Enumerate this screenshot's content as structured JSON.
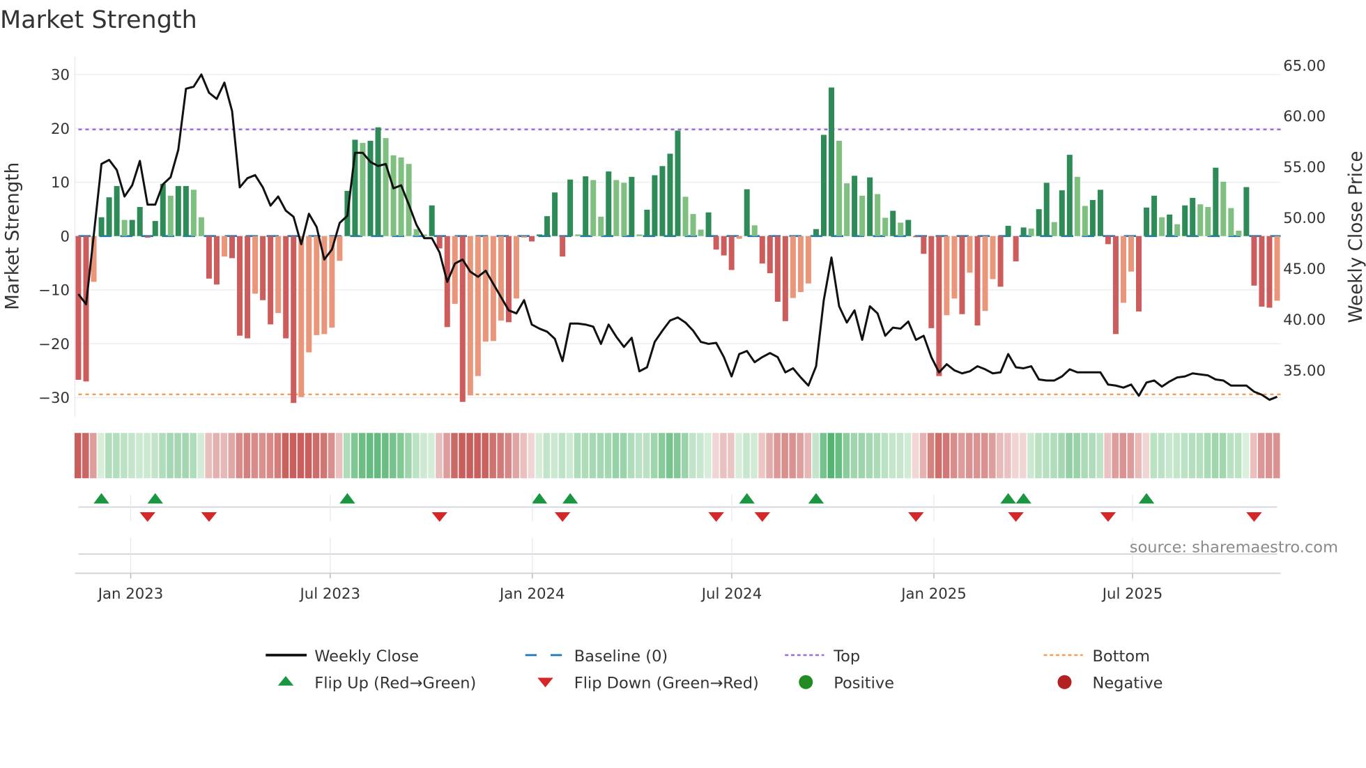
{
  "chart_data": {
    "type": "bar",
    "title": "Market Strength",
    "ylabel": "Market Strength",
    "y2label": "Weekly Close Price",
    "ylim": [
      -33.5,
      33.3
    ],
    "y2lim": [
      30.5,
      65.9
    ],
    "yticks": [
      "30",
      "20",
      "10",
      "0",
      "−10",
      "−20",
      "−30"
    ],
    "ytick_values": [
      30,
      20,
      10,
      0,
      -10,
      -20,
      -30
    ],
    "y2ticks": [
      "65.00",
      "60.00",
      "55.00",
      "50.00",
      "45.00",
      "40.00",
      "35.00"
    ],
    "y2tick_values": [
      65,
      60,
      55,
      50,
      45,
      40,
      35
    ],
    "xticks": [
      "Jan 2023",
      "Jul 2023",
      "Jan 2024",
      "Jul 2024",
      "Jan 2025",
      "Jul 2025"
    ],
    "grid": true,
    "top_level": 19.8,
    "bottom_level": -29.4,
    "series": [
      {
        "name": "Market Strength",
        "type": "bar",
        "values": [
          -26.7,
          -27,
          -8.5,
          3.5,
          7.2,
          9.3,
          3,
          3,
          5.4,
          -0.3,
          2.8,
          9.7,
          7.5,
          9.3,
          9.3,
          8.6,
          3.5,
          -7.9,
          -9,
          -3.8,
          -4.1,
          -18.5,
          -19,
          -10.7,
          -11.9,
          -16.4,
          -14.3,
          -19,
          -31,
          -29.9,
          -21.6,
          -18.4,
          -18.2,
          -17,
          -4.6,
          8.4,
          17.9,
          17.3,
          17.7,
          20.2,
          18.2,
          15,
          14.6,
          13.4,
          1.3,
          0.3,
          5.7,
          -2.3,
          -16.9,
          -12.6,
          -30.8,
          -29.6,
          -26,
          -19.6,
          -19.5,
          -15.7,
          -16,
          -11.6,
          -0.3,
          -1,
          0.3,
          3.7,
          8.1,
          -3.8,
          10.5,
          0.3,
          11.1,
          10.4,
          3.6,
          12,
          10.4,
          9.9,
          11,
          0.3,
          4.9,
          11.3,
          13,
          15.3,
          19.6,
          7.3,
          4.1,
          1.2,
          4.4,
          -2.5,
          -3.6,
          -6.3,
          -0.5,
          8.7,
          2,
          -5.1,
          -6.9,
          -12.2,
          -15.8,
          -11.5,
          -10.4,
          -8.8,
          1.3,
          18.8,
          27.6,
          17.7,
          9.8,
          11.2,
          7.5,
          10.9,
          7.8,
          3.4,
          4.7,
          2.5,
          3,
          -0.2,
          -3.3,
          -17.1,
          -26,
          -14.7,
          -11.6,
          -14.5,
          -6.8,
          -16.6,
          -13.9,
          -8,
          -9.4,
          1.9,
          -4.7,
          1.6,
          1.4,
          5,
          9.9,
          2.6,
          8.5,
          15.1,
          11,
          5.6,
          6.7,
          8.6,
          -1.5,
          -18.2,
          -12.4,
          -6.6,
          -14,
          5.3,
          7.5,
          3.5,
          4,
          2.2,
          5.7,
          7.1,
          5.9,
          5.4,
          12.7,
          10.1,
          5.2,
          1,
          9.1,
          -9.2,
          -13.1,
          -13.3,
          -12
        ]
      },
      {
        "name": "Weekly Close",
        "type": "line",
        "axis": "right",
        "values": [
          42.5,
          41.5,
          48.3,
          55.3,
          55.7,
          54.7,
          52.1,
          53.2,
          55.6,
          51.3,
          51.3,
          53.3,
          54,
          56.7,
          62.7,
          62.9,
          64.1,
          62.3,
          61.7,
          63.3,
          60.5,
          53,
          53.9,
          54.2,
          53,
          51.2,
          52.1,
          50.7,
          50.1,
          47.4,
          50.4,
          49.1,
          45.9,
          46.9,
          49.5,
          50.2,
          56.4,
          56.4,
          55.5,
          55.1,
          55.3,
          52.9,
          53.2,
          51.3,
          49.3,
          48,
          48,
          46.6,
          43.7,
          45.5,
          45.9,
          44.7,
          44.2,
          44.8,
          43.5,
          42.2,
          40.9,
          40.6,
          41.9,
          39.5,
          39.1,
          38.8,
          38.1,
          35.9,
          39.6,
          39.6,
          39.5,
          39.3,
          37.6,
          39.5,
          38.3,
          37.3,
          38.2,
          34.9,
          35.3,
          37.8,
          38.9,
          39.9,
          40.2,
          39.7,
          38.9,
          37.8,
          37.6,
          37.7,
          36.3,
          34.4,
          36.6,
          36.9,
          35.8,
          36.3,
          36.7,
          36.3,
          34.8,
          35.2,
          34.3,
          33.5,
          35.4,
          41.9,
          46.1,
          41.3,
          39.7,
          40.9,
          38,
          41.3,
          40.6,
          38.4,
          39.2,
          39.1,
          39.8,
          38,
          38.4,
          36.3,
          34.8,
          35.6,
          35,
          34.7,
          34.9,
          35.4,
          35.1,
          34.7,
          34.8,
          36.6,
          35.3,
          35.2,
          35.4,
          34.1,
          34,
          34,
          34.4,
          35.1,
          34.8,
          34.8,
          34.8,
          34.8,
          33.6,
          33.5,
          33.3,
          33.6,
          32.5,
          33.8,
          34,
          33.4,
          33.9,
          34.3,
          34.4,
          34.7,
          34.6,
          34.5,
          34.1,
          34,
          33.5,
          33.5,
          33.5,
          32.9,
          32.6,
          32.1,
          32.4
        ]
      }
    ],
    "flip_up_weeks": [
      3,
      10,
      35,
      60,
      64,
      87,
      96,
      121,
      123,
      139
    ],
    "flip_down_weeks": [
      9,
      17,
      47,
      63,
      83,
      89,
      109,
      122,
      134,
      153
    ],
    "legend_position": "bottom",
    "legend": [
      {
        "label": "Weekly Close",
        "kind": "line",
        "color": "#111111"
      },
      {
        "label": "Baseline (0)",
        "kind": "dash",
        "color": "#1f77b4"
      },
      {
        "label": "Top",
        "kind": "dot",
        "color": "#9b6bdc"
      },
      {
        "label": "Bottom",
        "kind": "dot",
        "color": "#f0a055"
      },
      {
        "label": "Flip Up (Red→Green)",
        "kind": "up",
        "color": "#1a9641"
      },
      {
        "label": "Flip Down (Green→Red)",
        "kind": "down",
        "color": "#d62728"
      },
      {
        "label": "Positive",
        "kind": "circle",
        "color": "#228b22"
      },
      {
        "label": "Negative",
        "kind": "circle",
        "color": "#b22222"
      }
    ],
    "source": "source: sharemaestro.com"
  },
  "colors": {
    "green_strong": "#2e8b57",
    "green_weak": "#7fbf7f",
    "red_strong": "#cd5c5c",
    "red_weak": "#e9967a",
    "baseline": "#1f77b4",
    "top": "#9b6bdc",
    "bottom": "#f0a055",
    "line": "#111111"
  }
}
